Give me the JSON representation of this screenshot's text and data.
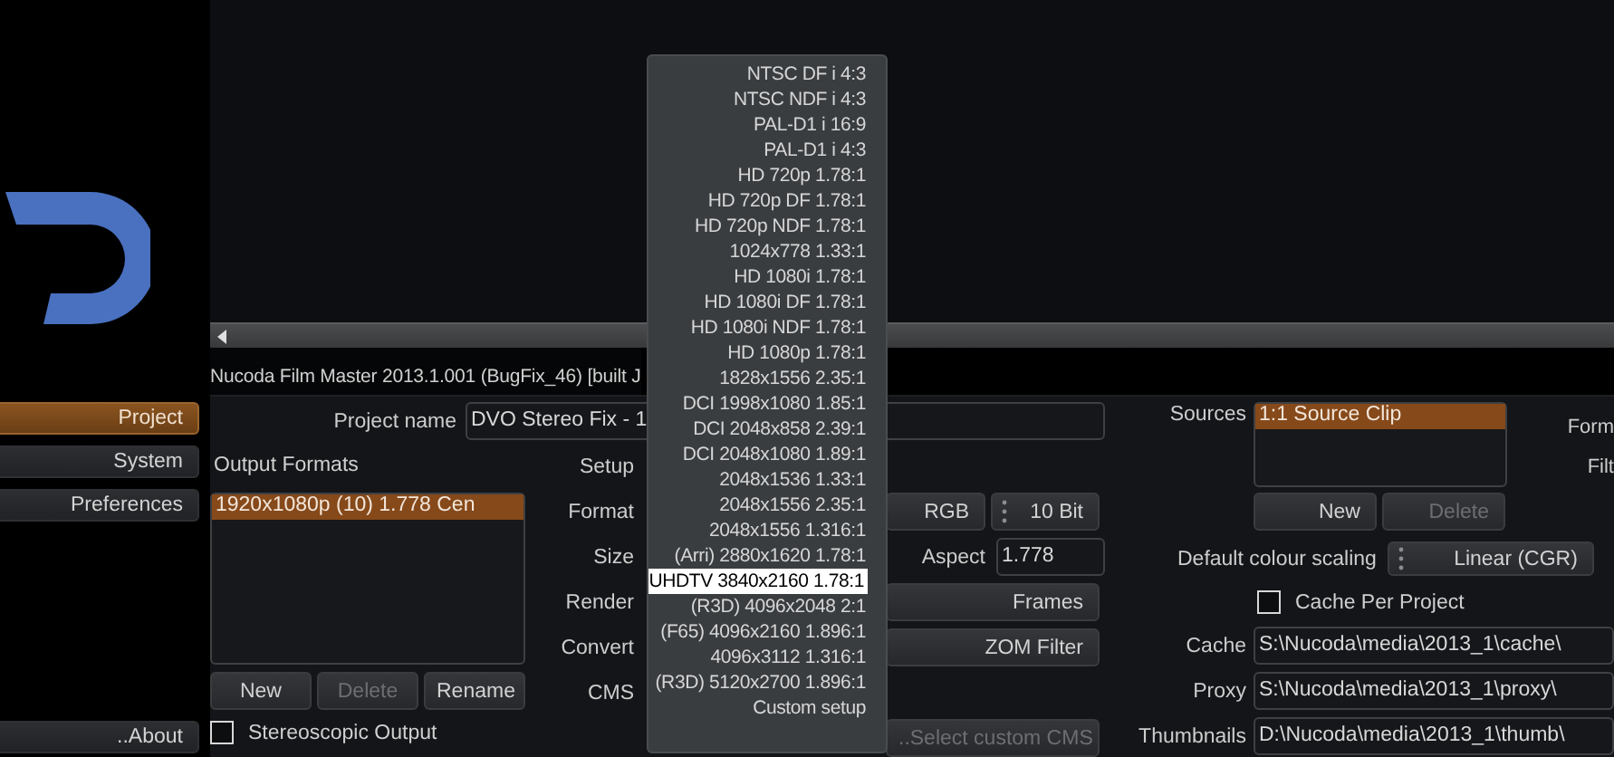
{
  "sidebar": {
    "items": [
      {
        "label": "Project",
        "selected": true
      },
      {
        "label": "System",
        "selected": false
      },
      {
        "label": "Preferences",
        "selected": false
      }
    ],
    "about_button": "..About"
  },
  "title_bar": {
    "text": "Nucoda Film Master 2013.1.001 (BugFix_46)  [built J"
  },
  "project": {
    "label": "Project name",
    "value": "DVO Stereo Fix - 1"
  },
  "output_formats": {
    "label": "Output Formats",
    "items": [
      {
        "label": "1920x1080p (10) 1.778 Cen",
        "selected": true
      }
    ],
    "buttons": [
      {
        "label": "New",
        "disabled": false
      },
      {
        "label": "Delete",
        "disabled": true
      },
      {
        "label": "Rename",
        "disabled": false
      }
    ],
    "stereoscopic": {
      "label": "Stereoscopic Output",
      "checked": false
    }
  },
  "settings": {
    "rows": [
      {
        "label": "Setup"
      },
      {
        "label": "Format",
        "controls": [
          {
            "kind": "button",
            "label": "RGB"
          },
          {
            "kind": "dropdown",
            "label": "10 Bit"
          }
        ]
      },
      {
        "label": "Size",
        "controls": [
          {
            "kind": "field",
            "label": "Aspect",
            "value": "1.778"
          }
        ]
      },
      {
        "label": "Render",
        "controls": [
          {
            "kind": "button",
            "label": "Frames"
          }
        ]
      },
      {
        "label": "Convert",
        "controls": [
          {
            "kind": "button",
            "label": "ZOM Filter"
          }
        ]
      },
      {
        "label": "CMS"
      },
      {
        "controls": [
          {
            "kind": "button",
            "label": "..Select custom CMS",
            "disabled": true
          }
        ]
      }
    ]
  },
  "format_menu": {
    "items": [
      {
        "label": "NTSC DF i 4:3",
        "selected": false
      },
      {
        "label": "NTSC NDF i 4:3",
        "selected": false
      },
      {
        "label": "PAL-D1 i 16:9",
        "selected": false
      },
      {
        "label": "PAL-D1 i 4:3",
        "selected": false
      },
      {
        "label": "HD 720p 1.78:1",
        "selected": false
      },
      {
        "label": "HD 720p DF 1.78:1",
        "selected": false
      },
      {
        "label": "HD 720p NDF 1.78:1",
        "selected": false
      },
      {
        "label": "1024x778 1.33:1",
        "selected": false
      },
      {
        "label": "HD 1080i 1.78:1",
        "selected": false
      },
      {
        "label": "HD 1080i DF 1.78:1",
        "selected": false
      },
      {
        "label": "HD 1080i NDF 1.78:1",
        "selected": false
      },
      {
        "label": "HD 1080p 1.78:1",
        "selected": false
      },
      {
        "label": "1828x1556 2.35:1",
        "selected": false
      },
      {
        "label": "DCI 1998x1080 1.85:1",
        "selected": false
      },
      {
        "label": "DCI 2048x858 2.39:1",
        "selected": false
      },
      {
        "label": "DCI 2048x1080 1.89:1",
        "selected": false
      },
      {
        "label": "2048x1536 1.33:1",
        "selected": false
      },
      {
        "label": "2048x1556 2.35:1",
        "selected": false
      },
      {
        "label": "2048x1556 1.316:1",
        "selected": false
      },
      {
        "label": "(Arri) 2880x1620 1.78:1",
        "selected": false
      },
      {
        "label": "UHDTV 3840x2160 1.78:1",
        "selected": true
      },
      {
        "label": "(R3D) 4096x2048 2:1",
        "selected": false
      },
      {
        "label": "(F65) 4096x2160 1.896:1",
        "selected": false
      },
      {
        "label": "4096x3112 1.316:1",
        "selected": false
      },
      {
        "label": "(R3D) 5120x2700 1.896:1",
        "selected": false
      },
      {
        "label": "Custom setup",
        "selected": false
      }
    ]
  },
  "sources": {
    "label": "Sources",
    "items": [
      {
        "label": "1:1 Source Clip",
        "selected": true
      }
    ],
    "buttons": [
      {
        "label": "New",
        "disabled": false
      },
      {
        "label": "Delete",
        "disabled": true
      }
    ],
    "side_labels": [
      "Form",
      "Filt"
    ]
  },
  "colour_scaling": {
    "label": "Default colour scaling",
    "value": "Linear (CGR)"
  },
  "cache_per_project": {
    "label": "Cache Per Project",
    "checked": false
  },
  "paths": [
    {
      "label": "Cache",
      "value": "S:\\Nucoda\\media\\2013_1\\cache\\"
    },
    {
      "label": "Proxy",
      "value": "S:\\Nucoda\\media\\2013_1\\proxy\\"
    },
    {
      "label": "Thumbnails",
      "value": "D:\\Nucoda\\media\\2013_1\\thumb\\"
    }
  ]
}
